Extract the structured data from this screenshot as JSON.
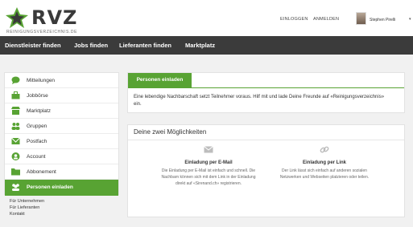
{
  "brand": {
    "logo_text": "RVZ",
    "subtitle": "REINIGUNGSVERZEICHNIS.DE",
    "accent": "#58a333",
    "dark": "#3b3b3b"
  },
  "header": {
    "login": "EINLOGGEN",
    "register": "ANMELDEN",
    "user_name": "Stephen Pirelli",
    "caret": "▾"
  },
  "nav": [
    "Dienstleister finden",
    "Jobs finden",
    "Lieferanten finden",
    "Marktplatz"
  ],
  "sidebar": {
    "items": [
      {
        "label": "Mitteilungen",
        "icon": "message-icon"
      },
      {
        "label": "Jobbörse",
        "icon": "briefcase-icon"
      },
      {
        "label": "Marktplatz",
        "icon": "shop-icon"
      },
      {
        "label": "Gruppen",
        "icon": "group-icon"
      },
      {
        "label": "Postfach",
        "icon": "mail-icon"
      },
      {
        "label": "Account",
        "icon": "user-icon"
      },
      {
        "label": "Abbonement",
        "icon": "folder-icon"
      },
      {
        "label": "Personen einladen",
        "icon": "invite-icon"
      }
    ],
    "links": [
      "Für Unternehmen",
      "Für Lieferanten",
      "Kontakt"
    ]
  },
  "invite": {
    "tab": "Personen einladen",
    "intro": "Eine lebendige Nachbarschaft setzt Teilnehmer voraus. Hilf mit und lade Deine Freunde auf «Reinigungsverzeichnis» ein."
  },
  "options": {
    "title": "Deine zwei Möglichkeiten",
    "email": {
      "title": "Einladung per E-Mail",
      "text": "Die Einladung per E-Mail ist einfach und schnell. Die Nachbarn können sich mit dem Link in der Einladung direkt auf «Sirenand.ch» registrieren."
    },
    "link": {
      "title": "Einladung per Link",
      "text": "Der Link lässt sich einfach auf anderen sozialen Netzwerken und Webseiten platzieren oder teilen."
    }
  }
}
